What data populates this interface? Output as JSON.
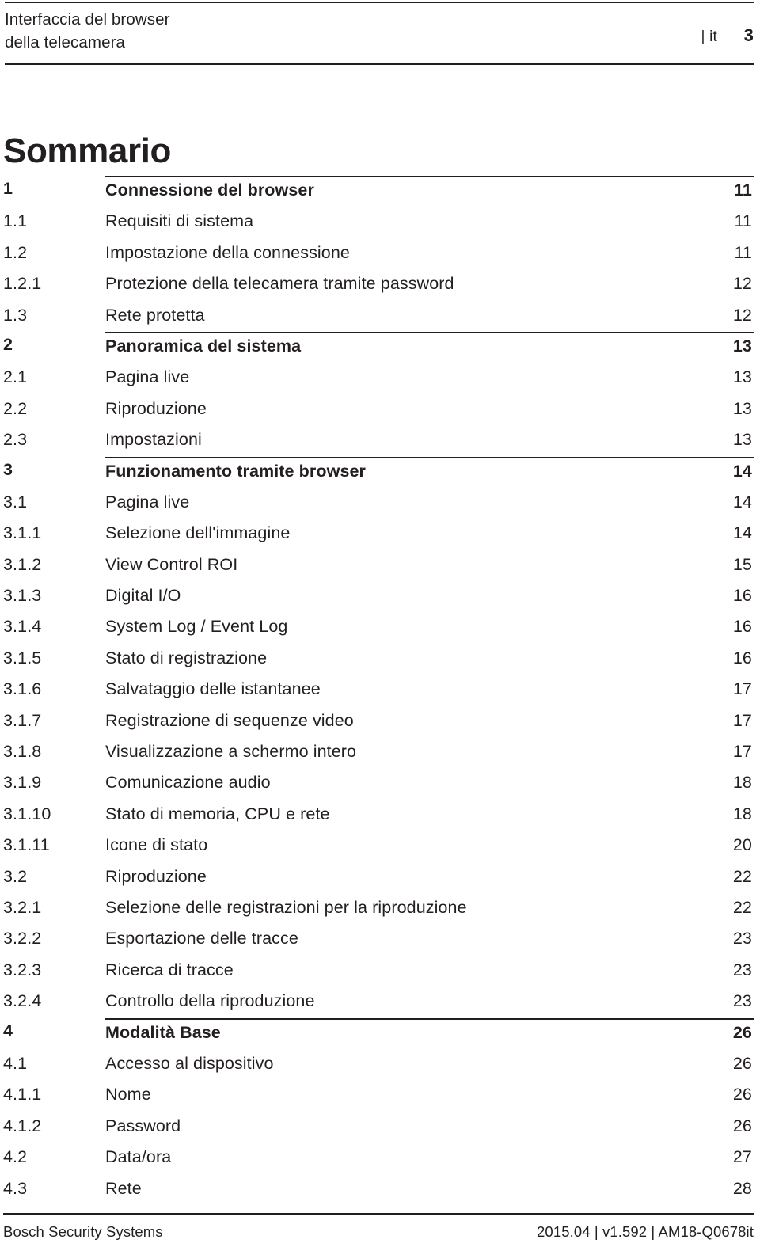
{
  "header": {
    "title": "Interfaccia del browser\ndella telecamera",
    "language_marker": "| it",
    "page_number": "3"
  },
  "document": {
    "title": "Sommario"
  },
  "toc": {
    "rows": [
      {
        "num": "1",
        "label": "Connessione del browser",
        "page": "11",
        "level": 1,
        "rule_above": true
      },
      {
        "num": "1.1",
        "label": "Requisiti di sistema",
        "page": "11",
        "level": 2,
        "rule_above": false
      },
      {
        "num": "1.2",
        "label": "Impostazione della connessione",
        "page": "11",
        "level": 2,
        "rule_above": false
      },
      {
        "num": "1.2.1",
        "label": "Protezione della telecamera tramite password",
        "page": "12",
        "level": 3,
        "rule_above": false
      },
      {
        "num": "1.3",
        "label": "Rete protetta",
        "page": "12",
        "level": 2,
        "rule_above": false
      },
      {
        "num": "2",
        "label": "Panoramica del sistema",
        "page": "13",
        "level": 1,
        "rule_above": true
      },
      {
        "num": "2.1",
        "label": "Pagina live",
        "page": "13",
        "level": 2,
        "rule_above": false
      },
      {
        "num": "2.2",
        "label": "Riproduzione",
        "page": "13",
        "level": 2,
        "rule_above": false
      },
      {
        "num": "2.3",
        "label": "Impostazioni",
        "page": "13",
        "level": 2,
        "rule_above": false
      },
      {
        "num": "3",
        "label": "Funzionamento tramite browser",
        "page": "14",
        "level": 1,
        "rule_above": true
      },
      {
        "num": "3.1",
        "label": "Pagina live",
        "page": "14",
        "level": 2,
        "rule_above": false
      },
      {
        "num": "3.1.1",
        "label": "Selezione dell'immagine",
        "page": "14",
        "level": 3,
        "rule_above": false
      },
      {
        "num": "3.1.2",
        "label": "View Control ROI",
        "page": "15",
        "level": 3,
        "rule_above": false
      },
      {
        "num": "3.1.3",
        "label": "Digital I/O",
        "page": "16",
        "level": 3,
        "rule_above": false
      },
      {
        "num": "3.1.4",
        "label": "System Log / Event Log",
        "page": "16",
        "level": 3,
        "rule_above": false
      },
      {
        "num": "3.1.5",
        "label": "Stato di registrazione",
        "page": "16",
        "level": 3,
        "rule_above": false
      },
      {
        "num": "3.1.6",
        "label": "Salvataggio delle istantanee",
        "page": "17",
        "level": 3,
        "rule_above": false
      },
      {
        "num": "3.1.7",
        "label": "Registrazione di sequenze video",
        "page": "17",
        "level": 3,
        "rule_above": false
      },
      {
        "num": "3.1.8",
        "label": "Visualizzazione a schermo intero",
        "page": "17",
        "level": 3,
        "rule_above": false
      },
      {
        "num": "3.1.9",
        "label": "Comunicazione audio",
        "page": "18",
        "level": 3,
        "rule_above": false
      },
      {
        "num": "3.1.10",
        "label": "Stato di memoria, CPU e rete",
        "page": "18",
        "level": 3,
        "rule_above": false
      },
      {
        "num": "3.1.11",
        "label": "Icone di stato",
        "page": "20",
        "level": 3,
        "rule_above": false
      },
      {
        "num": "3.2",
        "label": "Riproduzione",
        "page": "22",
        "level": 2,
        "rule_above": false
      },
      {
        "num": "3.2.1",
        "label": "Selezione delle registrazioni per la riproduzione",
        "page": "22",
        "level": 3,
        "rule_above": false
      },
      {
        "num": "3.2.2",
        "label": "Esportazione delle tracce",
        "page": "23",
        "level": 3,
        "rule_above": false
      },
      {
        "num": "3.2.3",
        "label": "Ricerca di tracce",
        "page": "23",
        "level": 3,
        "rule_above": false
      },
      {
        "num": "3.2.4",
        "label": "Controllo della riproduzione",
        "page": "23",
        "level": 3,
        "rule_above": false
      },
      {
        "num": "4",
        "label": "Modalità Base",
        "page": "26",
        "level": 1,
        "rule_above": true
      },
      {
        "num": "4.1",
        "label": "Accesso al dispositivo",
        "page": "26",
        "level": 2,
        "rule_above": false
      },
      {
        "num": "4.1.1",
        "label": "Nome",
        "page": "26",
        "level": 3,
        "rule_above": false
      },
      {
        "num": "4.1.2",
        "label": "Password",
        "page": "26",
        "level": 3,
        "rule_above": false
      },
      {
        "num": "4.2",
        "label": "Data/ora",
        "page": "27",
        "level": 2,
        "rule_above": false
      },
      {
        "num": "4.3",
        "label": "Rete",
        "page": "28",
        "level": 2,
        "rule_above": false
      }
    ]
  },
  "footer": {
    "left": "Bosch Security Systems",
    "right": "2015.04 | v1.592 | AM18-Q0678it"
  },
  "colors": {
    "ink": "#231f20",
    "background": "#ffffff"
  }
}
